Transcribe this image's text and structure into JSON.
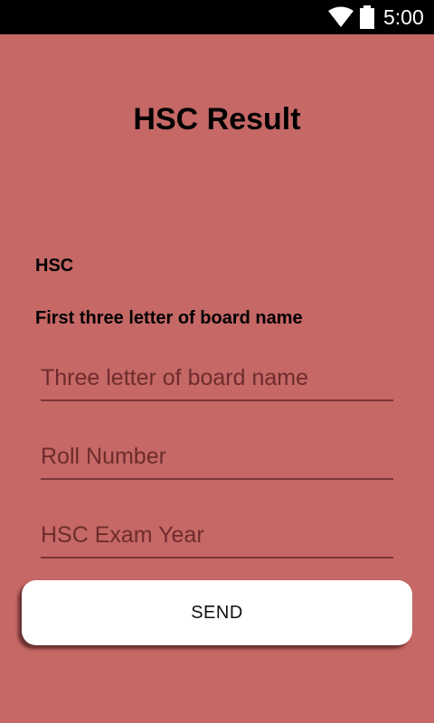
{
  "status_bar": {
    "time": "5:00",
    "icons": [
      "wifi-icon",
      "battery-icon"
    ],
    "background": "#000000"
  },
  "screen": {
    "background": "#c56866"
  },
  "header": {
    "title": "HSC Result"
  },
  "form": {
    "exam_label": "HSC",
    "board_label": "First three letter of board name",
    "fields": [
      {
        "name": "board",
        "value": "",
        "placeholder": "Three letter of board name"
      },
      {
        "name": "roll",
        "value": "",
        "placeholder": "Roll Number"
      },
      {
        "name": "year",
        "value": "",
        "placeholder": "HSC Exam Year"
      }
    ],
    "send_label": "SEND"
  }
}
